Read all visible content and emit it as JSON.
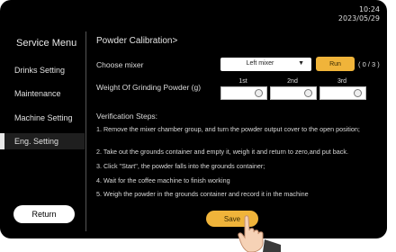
{
  "status": {
    "time": "10:24",
    "date": "2023/05/29"
  },
  "sidebar": {
    "title": "Service Menu",
    "items": [
      {
        "label": "Drinks Setting"
      },
      {
        "label": "Maintenance"
      },
      {
        "label": "Machine Setting"
      },
      {
        "label": "Eng. Setting",
        "active": true
      }
    ],
    "return_label": "Return"
  },
  "main": {
    "title": "Powder Calibration>",
    "choose_mixer_label": "Choose mixer",
    "mixer_selected": "Left mixer",
    "run_label": "Run",
    "run_count": "( 0 / 3 )",
    "weight_label": "Weight Of Grinding Powder (g)",
    "columns": [
      "1st",
      "2nd",
      "3rd"
    ],
    "verification_title": "Verification Steps:",
    "steps": [
      "1. Remove the mixer chamber group, and turn the powder output cover to the open position;",
      "2. Take out the grounds container and empty it, weigh it and return to zero,and put back.",
      "3. Click \"Start\", the powder falls into the grounds container;",
      "4. Wait for the coffee machine to finish working",
      "5. Weigh the powder in the grounds container and record it in the machine"
    ],
    "save_label": "Save"
  },
  "colors": {
    "accent": "#f0b43a",
    "background": "#000000",
    "text": "#e0e0e0"
  }
}
